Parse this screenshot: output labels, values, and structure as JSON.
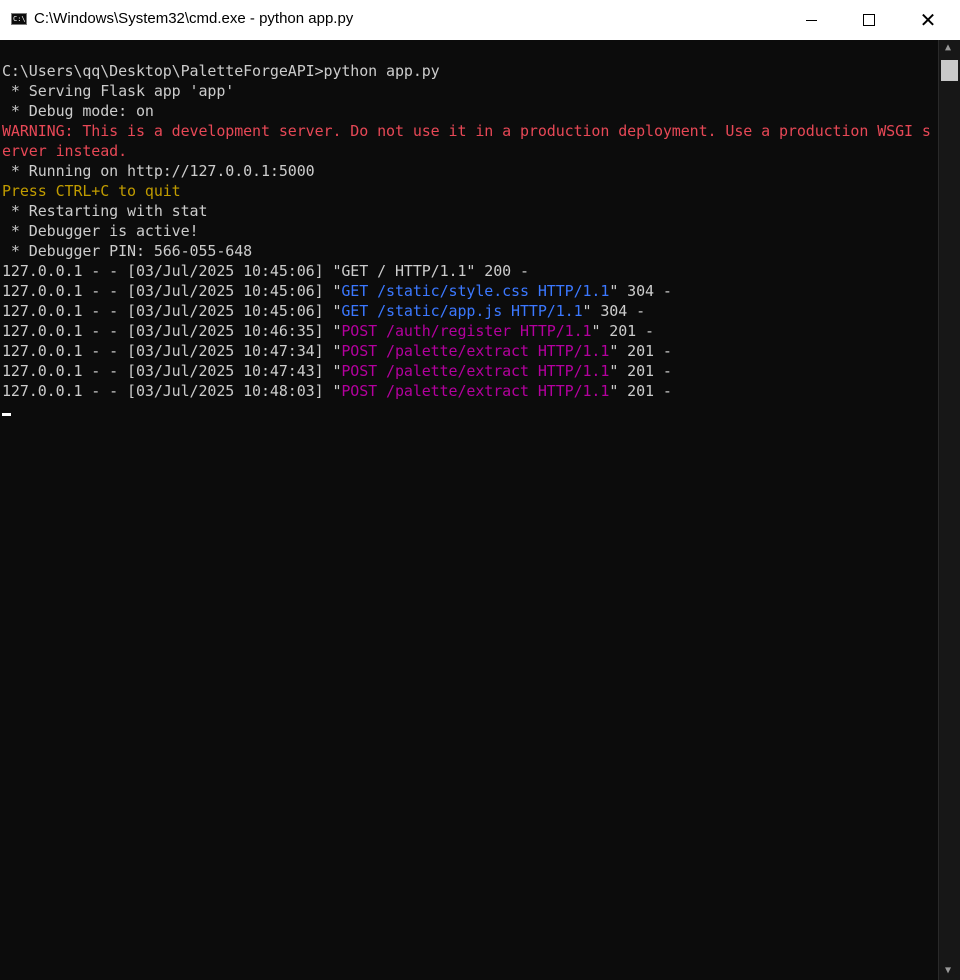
{
  "window": {
    "title": "C:\\Windows\\System32\\cmd.exe - python  app.py",
    "app_icon_text": "C:\\",
    "icons": {
      "app": "cmd-icon",
      "minimize": "minimize-icon",
      "maximize": "maximize-icon",
      "close": "close-icon"
    },
    "close_glyph": "✕"
  },
  "console": {
    "background": "#0c0c0c",
    "colors": {
      "default": "#cccccc",
      "red": "#e74856",
      "yellow": "#c19c00",
      "blue": "#3b78ff",
      "magenta": "#b4009e"
    },
    "lines": [
      {
        "segments": [
          {
            "text": "C:\\Users\\qq\\Desktop\\PaletteForgeAPI>python app.py",
            "color": "default"
          }
        ]
      },
      {
        "segments": [
          {
            "text": " * Serving Flask app 'app'",
            "color": "default"
          }
        ]
      },
      {
        "segments": [
          {
            "text": " * Debug mode: on",
            "color": "default"
          }
        ]
      },
      {
        "segments": [
          {
            "text": "WARNING: This is a development server. Do not use it in a production deployment. Use a production WSGI s",
            "color": "red"
          }
        ]
      },
      {
        "segments": [
          {
            "text": "erver instead.",
            "color": "red"
          }
        ]
      },
      {
        "segments": [
          {
            "text": " * Running on http://127.0.0.1:5000",
            "color": "default"
          }
        ]
      },
      {
        "segments": [
          {
            "text": "Press CTRL+C to quit",
            "color": "yellow"
          }
        ]
      },
      {
        "segments": [
          {
            "text": " * Restarting with stat",
            "color": "default"
          }
        ]
      },
      {
        "segments": [
          {
            "text": " * Debugger is active!",
            "color": "default"
          }
        ]
      },
      {
        "segments": [
          {
            "text": " * Debugger PIN: 566-055-648",
            "color": "default"
          }
        ]
      },
      {
        "segments": [
          {
            "text": "127.0.0.1 - - [03/Jul/2025 10:45:06] \"GET / HTTP/1.1\" 200 -",
            "color": "default"
          }
        ]
      },
      {
        "segments": [
          {
            "text": "127.0.0.1 - - [03/Jul/2025 10:45:06] \"",
            "color": "default"
          },
          {
            "text": "GET /static/style.css HTTP/1.1",
            "color": "blue"
          },
          {
            "text": "\" 304 -",
            "color": "default"
          }
        ]
      },
      {
        "segments": [
          {
            "text": "127.0.0.1 - - [03/Jul/2025 10:45:06] \"",
            "color": "default"
          },
          {
            "text": "GET /static/app.js HTTP/1.1",
            "color": "blue"
          },
          {
            "text": "\" 304 -",
            "color": "default"
          }
        ]
      },
      {
        "segments": [
          {
            "text": "127.0.0.1 - - [03/Jul/2025 10:46:35] \"",
            "color": "default"
          },
          {
            "text": "POST /auth/register HTTP/1.1",
            "color": "magenta"
          },
          {
            "text": "\" 201 -",
            "color": "default"
          }
        ]
      },
      {
        "segments": [
          {
            "text": "127.0.0.1 - - [03/Jul/2025 10:47:34] \"",
            "color": "default"
          },
          {
            "text": "POST /palette/extract HTTP/1.1",
            "color": "magenta"
          },
          {
            "text": "\" 201 -",
            "color": "default"
          }
        ]
      },
      {
        "segments": [
          {
            "text": "127.0.0.1 - - [03/Jul/2025 10:47:43] \"",
            "color": "default"
          },
          {
            "text": "POST /palette/extract HTTP/1.1",
            "color": "magenta"
          },
          {
            "text": "\" 201 -",
            "color": "default"
          }
        ]
      },
      {
        "segments": [
          {
            "text": "127.0.0.1 - - [03/Jul/2025 10:48:03] \"",
            "color": "default"
          },
          {
            "text": "POST /palette/extract HTTP/1.1",
            "color": "magenta"
          },
          {
            "text": "\" 201 -",
            "color": "default"
          }
        ]
      }
    ]
  },
  "scrollbar": {
    "up_glyph": "▲",
    "down_glyph": "▼"
  }
}
